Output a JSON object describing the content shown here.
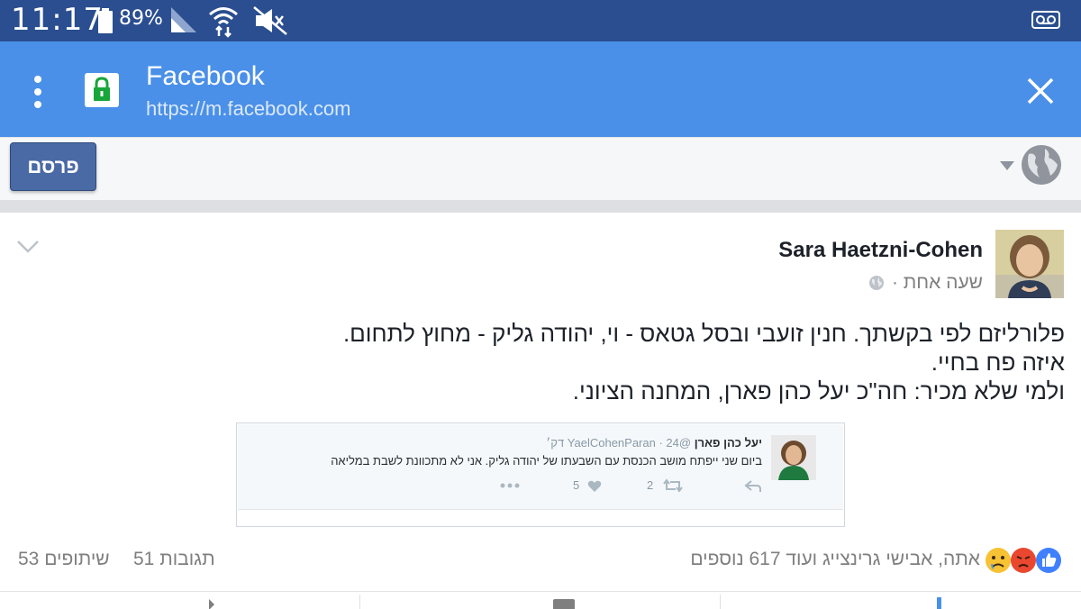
{
  "status_bar": {
    "time": "11:17",
    "battery_percent": "89%"
  },
  "browser": {
    "title": "Facebook",
    "url": "https://m.facebook.com",
    "accent_color": "#4a90e8"
  },
  "composer": {
    "post_label": "פרסם"
  },
  "post": {
    "author": "Sara Haetzni-Cohen",
    "time_ago": "שעה אחת ·",
    "text_lines": [
      "פלורליזם לפי בקשתך. חנין זועבי ובסל גטאס - וי, יהודה גליק - מחוץ לתחום.",
      "איזה פח בחיי.",
      "ולמי שלא מכיר: חה\"כ יעל כהן פארן, המחנה הציוני."
    ],
    "embedded_tweet": {
      "name": "יעל כהן פארן",
      "handle": "@YaelCohenParan",
      "time": "· 24 דק׳",
      "text": "ביום שני ייפתח מושב הכנסת עם השבעתו של יהודה גליק. אני לא מתכוונת לשבת במליאה",
      "retweets": "2",
      "likes": "5"
    },
    "reactions_text": "אתה, אבישי גרינצייג ועוד 617 נוספים",
    "comments_count": "51 תגובות",
    "shares_count": "53 שיתופים"
  }
}
